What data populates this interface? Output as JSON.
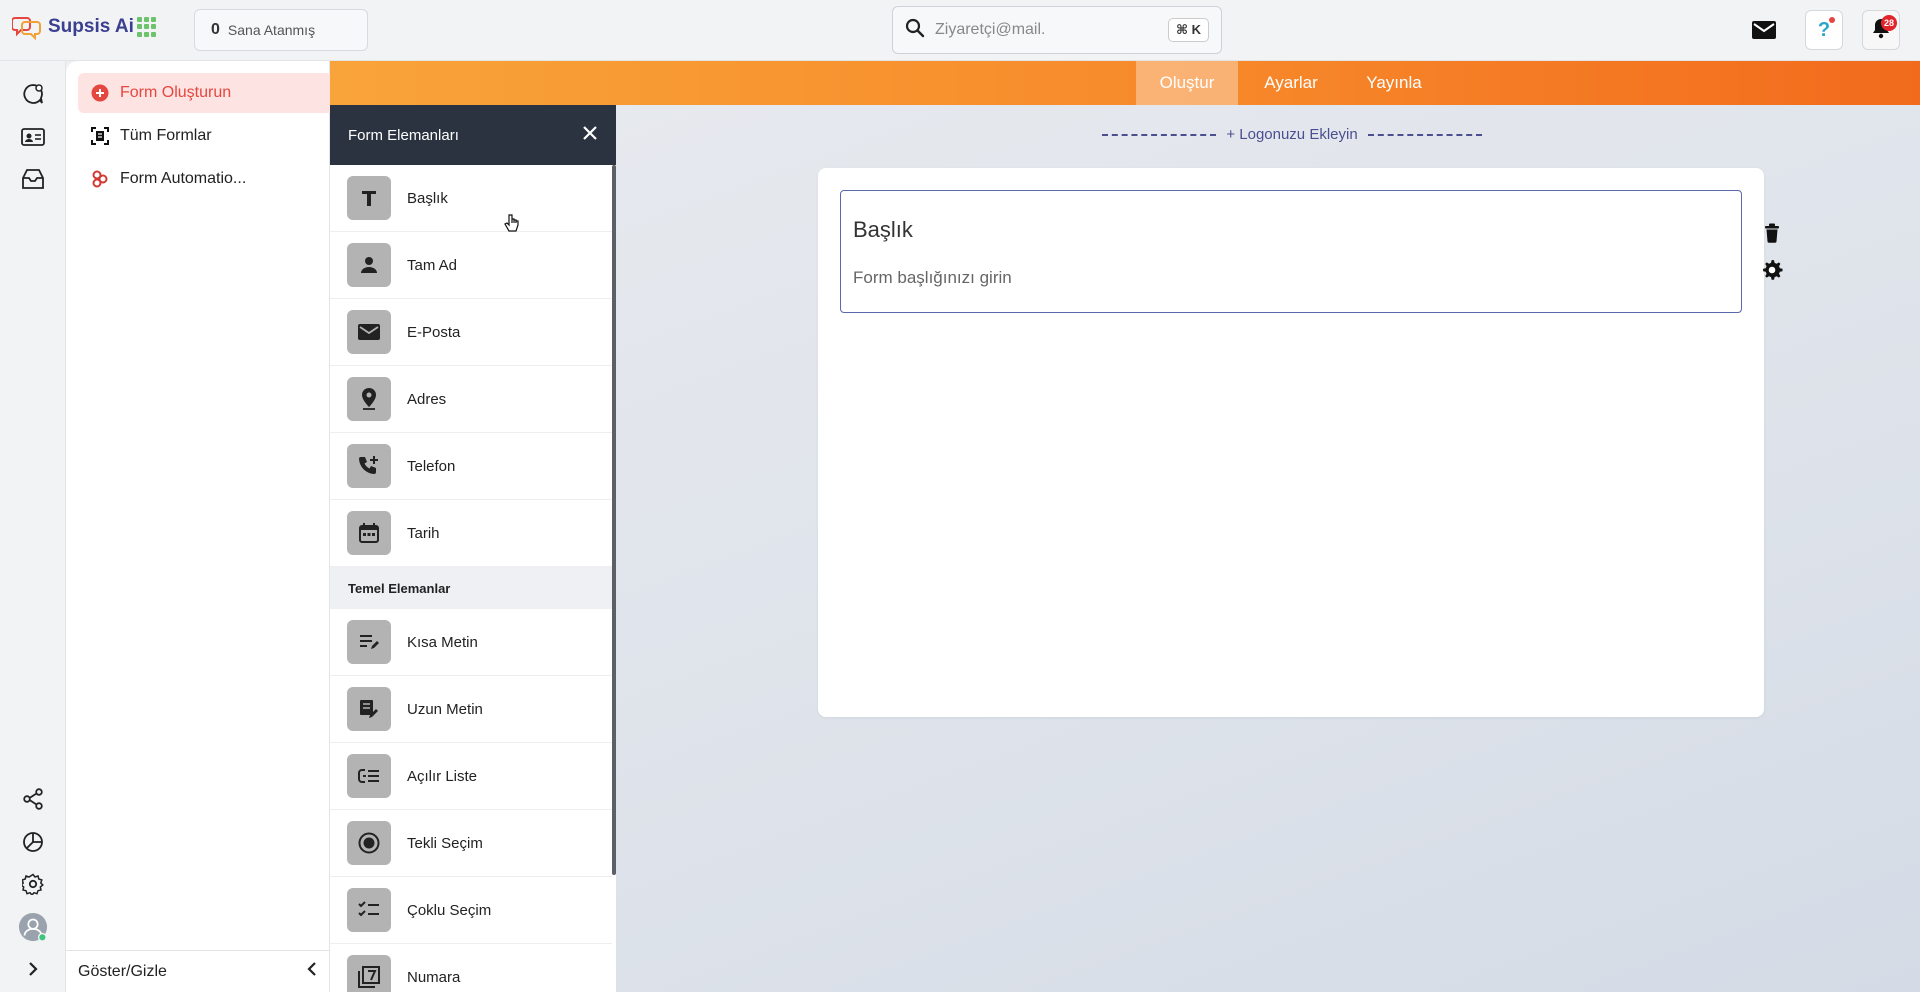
{
  "app": {
    "name": "Supsis Ai"
  },
  "topbar": {
    "assigned_count": "0",
    "assigned_label": "Sana Atanmış",
    "search_placeholder": "Ziyaretçi@mail.",
    "search_shortcut": "⌘ K",
    "notification_count": "28",
    "help_glyph": "?"
  },
  "sidebar": {
    "items": [
      {
        "label": "Form Oluşturun",
        "icon": "plus-circle-icon",
        "active": true
      },
      {
        "label": "Tüm Formlar",
        "icon": "forms-icon",
        "active": false
      },
      {
        "label": "Form Automatio...",
        "icon": "automation-icon",
        "active": false
      }
    ],
    "footer_label": "Göster/Gizle"
  },
  "header_tabs": [
    {
      "label": "Oluştur",
      "active": true
    },
    {
      "label": "Ayarlar",
      "active": false
    },
    {
      "label": "Yayınla",
      "active": false
    }
  ],
  "panel": {
    "title": "Form Elemanları",
    "elements_top": [
      {
        "label": "Başlık",
        "icon": "text-title-icon"
      },
      {
        "label": "Tam Ad",
        "icon": "person-icon"
      },
      {
        "label": "E-Posta",
        "icon": "mail-icon"
      },
      {
        "label": "Adres",
        "icon": "location-pin-icon"
      },
      {
        "label": "Telefon",
        "icon": "phone-add-icon"
      },
      {
        "label": "Tarih",
        "icon": "calendar-icon"
      }
    ],
    "section_label": "Temel Elemanlar",
    "elements_basic": [
      {
        "label": "Kısa Metin",
        "icon": "short-text-icon"
      },
      {
        "label": "Uzun Metin",
        "icon": "long-text-icon"
      },
      {
        "label": "Açılır Liste",
        "icon": "dropdown-list-icon"
      },
      {
        "label": "Tekli Seçim",
        "icon": "radio-icon"
      },
      {
        "label": "Çoklu Seçim",
        "icon": "checklist-icon"
      },
      {
        "label": "Numara",
        "icon": "number-icon"
      }
    ]
  },
  "canvas": {
    "add_logo_label": "+ Logonuzu Ekleyin",
    "form_title": "Başlık",
    "form_subtitle": "Form başlığınızı girin"
  },
  "colors": {
    "brand": "#3a3f8f",
    "accent_orange": "#f7892a",
    "active_red": "#e5463f",
    "panel_header": "#2b3340"
  }
}
